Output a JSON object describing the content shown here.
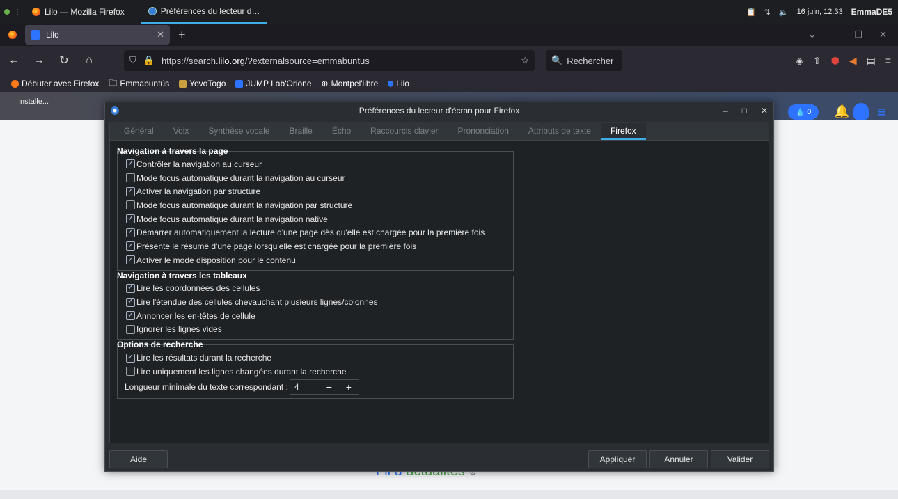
{
  "system_panel": {
    "window_title": "Lilo — Mozilla Firefox",
    "active_window": "Préférences du lecteur d…",
    "datetime": "16 juin, 12:33",
    "user": "EmmaDE5"
  },
  "browser": {
    "tab_title": "Lilo",
    "url_prefix": "https://search.",
    "url_domain": "lilo.org",
    "url_suffix": "/?externalsource=emmabuntus",
    "search_placeholder": "Rechercher",
    "bookmarks": [
      {
        "label": "Débuter avec Firefox",
        "icon": "firefox-icon"
      },
      {
        "label": "Emmabuntüs",
        "icon": "folder-icon"
      },
      {
        "label": "YovoTogo",
        "icon": "yovotogo-icon"
      },
      {
        "label": "JUMP Lab'Orione",
        "icon": "jump-icon"
      },
      {
        "label": "Montpel'libre",
        "icon": "globe-icon"
      },
      {
        "label": "Lilo",
        "icon": "lilo-drop-icon"
      }
    ]
  },
  "page": {
    "drop_count": "0",
    "news_prefix": "Fil d",
    "news_suffix": "actualités",
    "desktop_icon_label": "Installe..."
  },
  "dialog": {
    "title": "Préférences du lecteur d'écran pour Firefox",
    "tabs": [
      "Général",
      "Voix",
      "Synthèse vocale",
      "Braille",
      "Écho",
      "Raccourcis clavier",
      "Prononciation",
      "Attributs de texte",
      "Firefox"
    ],
    "active_tab": "Firefox",
    "groups": [
      {
        "title": "Navigation à travers la page",
        "options": [
          {
            "label": "Contrôler la navigation au curseur",
            "checked": true
          },
          {
            "label": "Mode focus automatique durant la navigation au curseur",
            "checked": false
          },
          {
            "label": "Activer la navigation par structure",
            "checked": true
          },
          {
            "label": "Mode focus automatique durant la navigation par structure",
            "checked": false
          },
          {
            "label": "Mode focus automatique durant la navigation native",
            "checked": true
          },
          {
            "label": "Démarrer automatiquement la lecture d'une page dès qu'elle est chargée pour la première fois",
            "checked": true
          },
          {
            "label": "Présente le résumé d'une page lorsqu'elle est chargée pour la première fois",
            "checked": true
          },
          {
            "label": "Activer le mode disposition pour le contenu",
            "checked": true
          }
        ]
      },
      {
        "title": "Navigation à travers les tableaux",
        "options": [
          {
            "label": "Lire les coordonnées des cellules",
            "checked": true
          },
          {
            "label": "Lire l'étendue des cellules chevauchant plusieurs lignes/colonnes",
            "checked": true
          },
          {
            "label": "Annoncer les en-têtes de cellule",
            "checked": true
          },
          {
            "label": "Ignorer les lignes vides",
            "checked": false
          }
        ]
      },
      {
        "title": "Options de recherche",
        "options": [
          {
            "label": "Lire les résultats durant la recherche",
            "checked": true
          },
          {
            "label": "Lire uniquement les lignes changées durant la recherche",
            "checked": false
          }
        ],
        "min_length_label": "Longueur minimale du texte correspondant :",
        "min_length_value": "4"
      }
    ],
    "buttons": {
      "help": "Aide",
      "apply": "Appliquer",
      "cancel": "Annuler",
      "ok": "Valider"
    }
  }
}
